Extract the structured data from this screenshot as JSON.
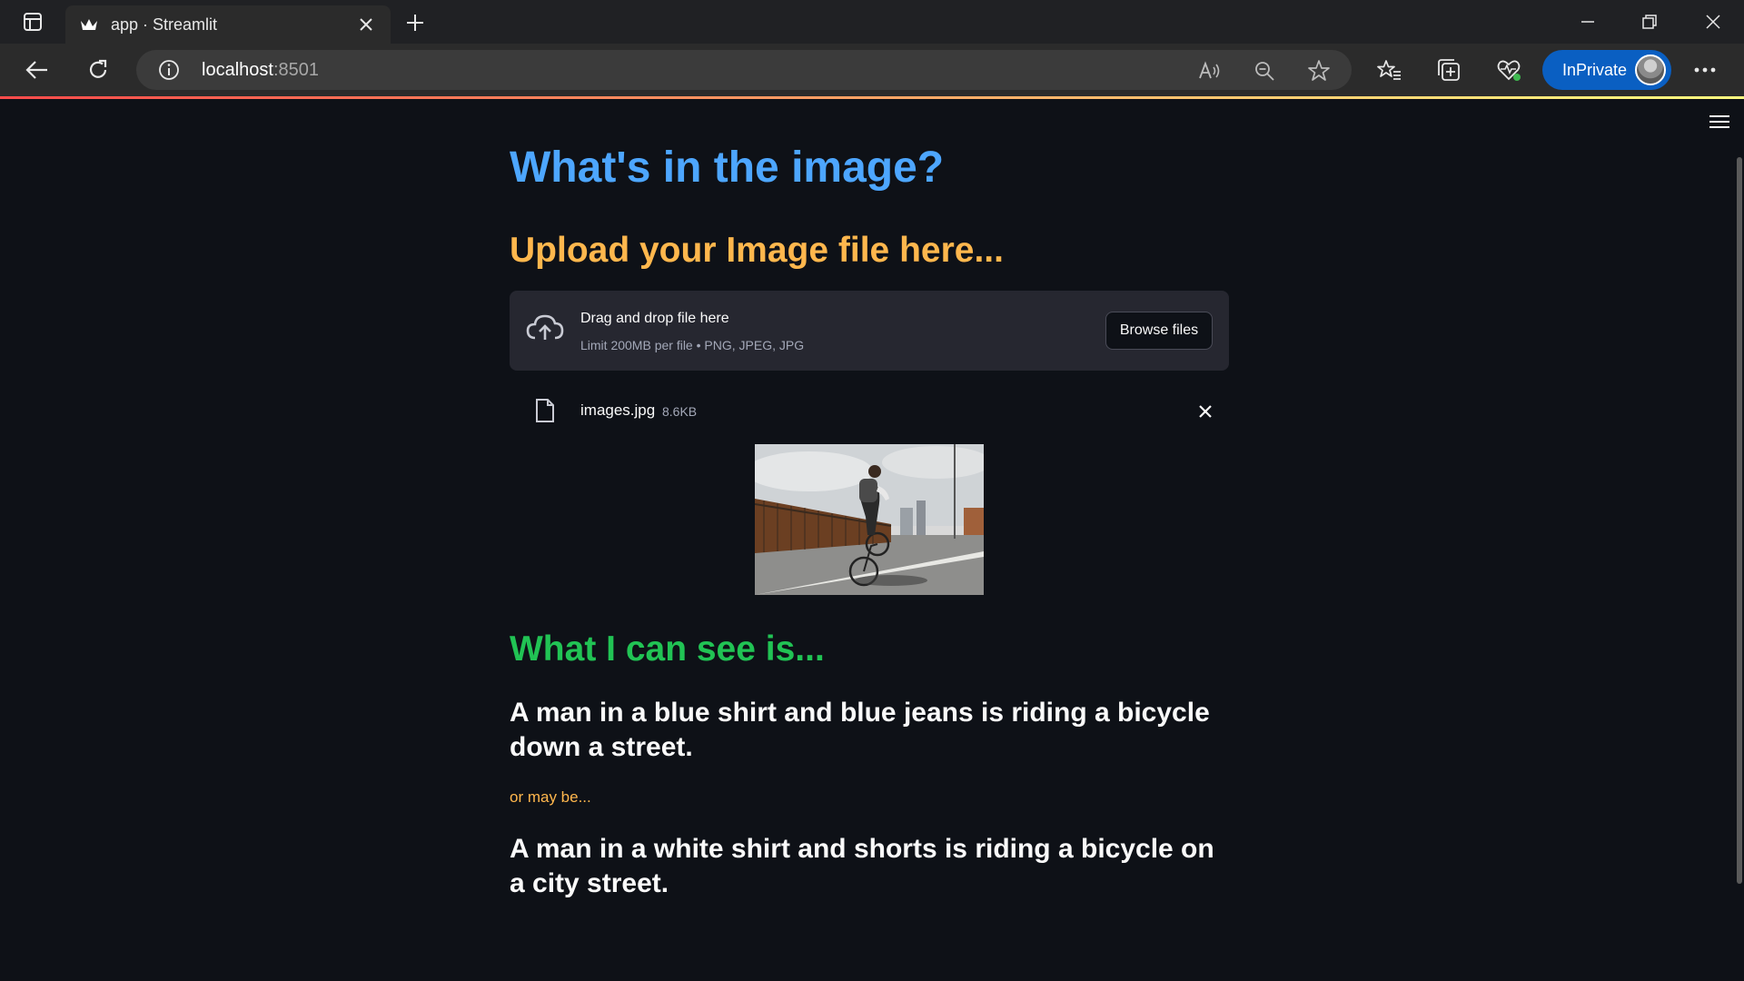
{
  "browser": {
    "tab_title": "app · Streamlit",
    "url_host": "localhost",
    "url_port": ":8501",
    "inprivate_label": "InPrivate"
  },
  "app": {
    "title": "What's in the image?",
    "upload_heading": "Upload your Image file here...",
    "uploader": {
      "drag_text": "Drag and drop file here",
      "limit_text": "Limit 200MB per file • PNG, JPEG, JPG",
      "browse_label": "Browse files"
    },
    "file": {
      "name": "images.jpg",
      "size": "8.6KB"
    },
    "result_heading": "What I can see is...",
    "caption_1": "A man in a blue shirt and blue jeans is riding a bicycle down a street.",
    "maybe_text": "or may be...",
    "caption_2": "A man in a white shirt and shorts is riding a bicycle on a city street."
  },
  "colors": {
    "title": "#4da6ff",
    "upload_heading": "#ffb74d",
    "result_heading": "#21c354",
    "background": "#0e1117",
    "inprivate": "#0a5fc2"
  },
  "icons": [
    "tab-actions-icon",
    "streamlit-crown-icon",
    "close-icon",
    "plus-icon",
    "minimize-icon",
    "restore-icon",
    "window-close-icon",
    "back-arrow-icon",
    "refresh-icon",
    "info-icon",
    "read-aloud-icon",
    "zoom-out-icon",
    "favorite-star-icon",
    "favorites-icon",
    "collections-icon",
    "browser-essentials-icon",
    "more-icon",
    "hamburger-menu-icon",
    "cloud-upload-icon",
    "file-icon",
    "remove-file-icon"
  ]
}
